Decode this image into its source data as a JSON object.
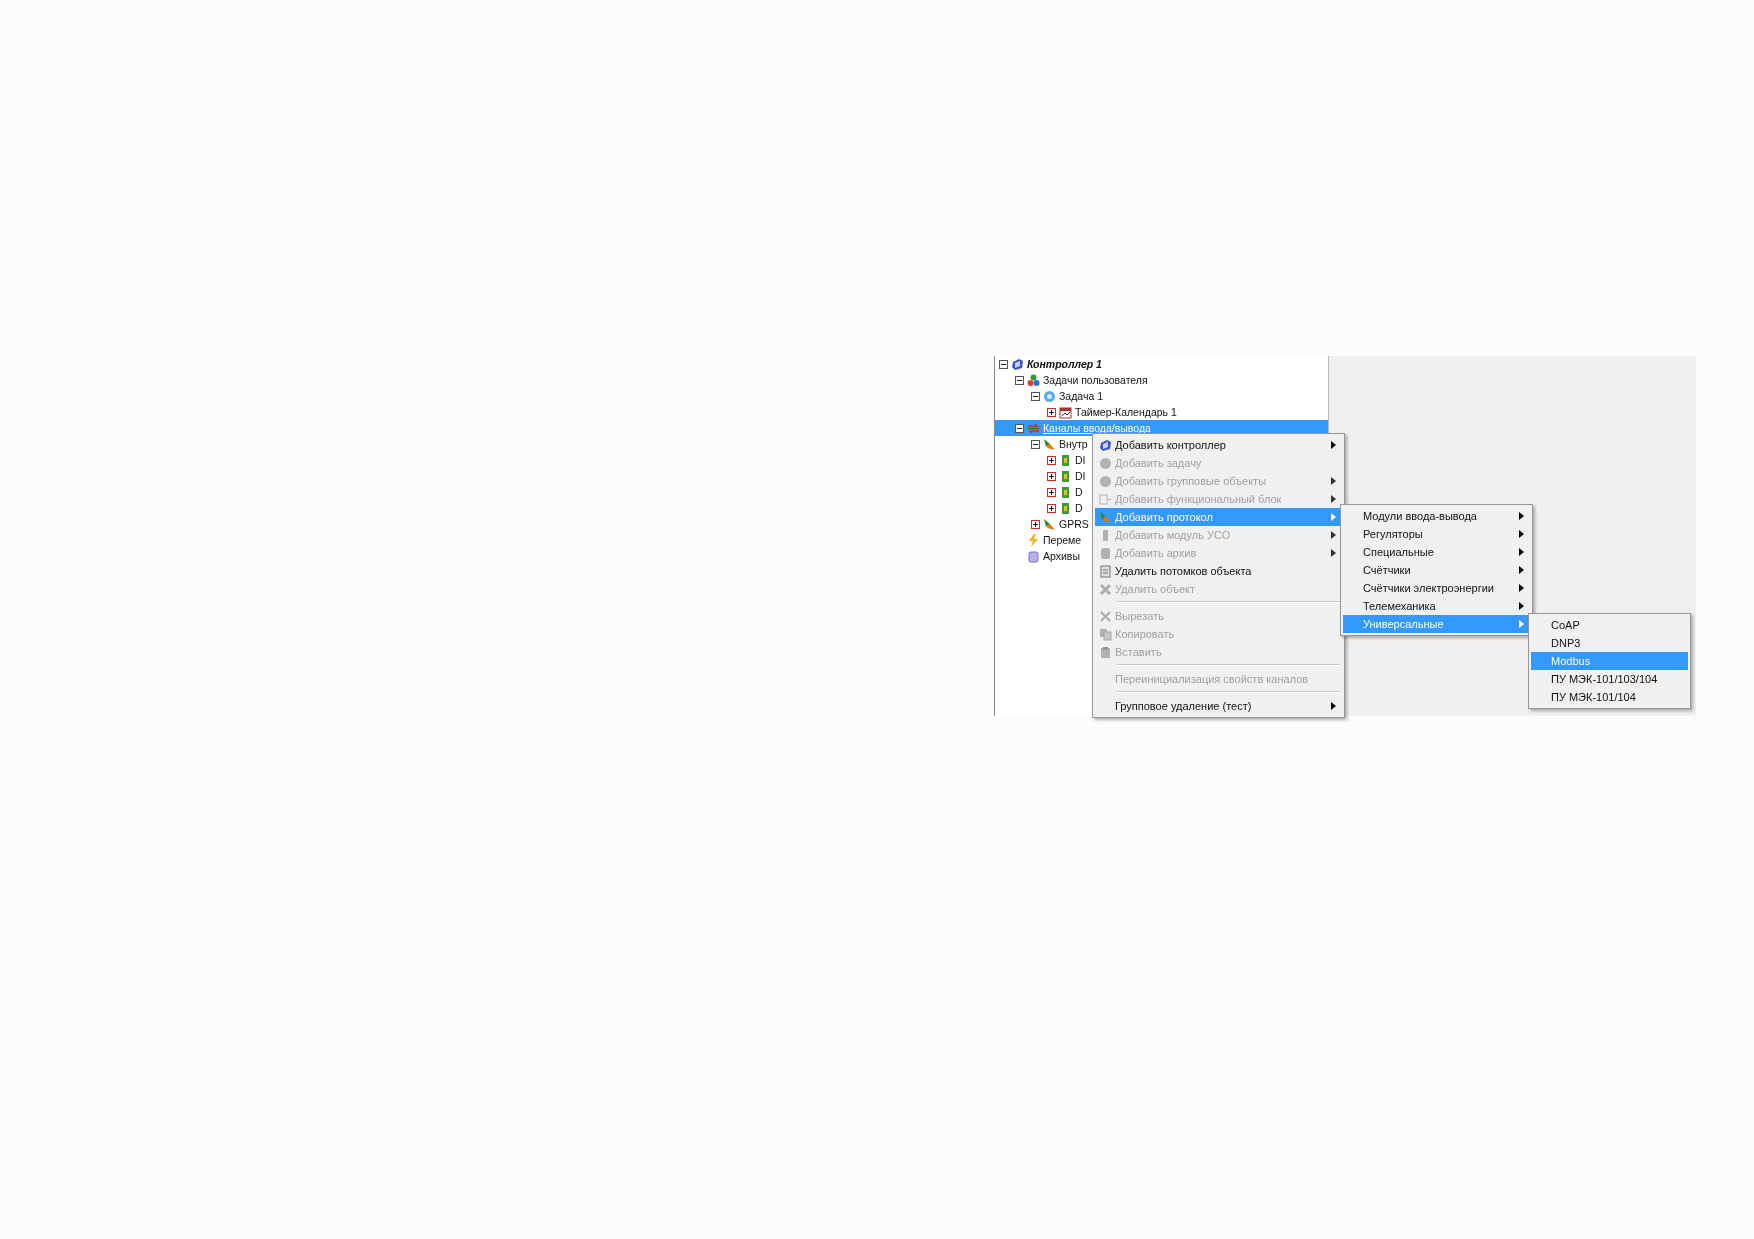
{
  "tree": [
    {
      "label": "Контроллер 1",
      "expanded": true,
      "selected": false,
      "children": [
        {
          "label": "Задачи пользователя",
          "expanded": true,
          "selected": false,
          "children": [
            {
              "label": "Задача 1",
              "expanded": true,
              "selected": false,
              "children": [
                {
                  "label": "Таймер-Календарь 1",
                  "expanded": false,
                  "selected": false
                }
              ]
            }
          ]
        },
        {
          "label": "Каналы ввода/вывода",
          "expanded": true,
          "selected": true,
          "children": [
            {
              "label": "Внутр",
              "expanded": true,
              "selected": false,
              "children": [
                {
                  "label": "DI",
                  "expanded": false,
                  "selected": false
                },
                {
                  "label": "DI",
                  "expanded": false,
                  "selected": false
                },
                {
                  "label": "D",
                  "expanded": false,
                  "selected": false
                },
                {
                  "label": "D",
                  "expanded": false,
                  "selected": false
                }
              ]
            },
            {
              "label": "GPRS",
              "expanded": false,
              "selected": false
            }
          ]
        },
        {
          "label": "Переме",
          "selected": false
        },
        {
          "label": "Архивы",
          "selected": false
        }
      ]
    }
  ],
  "context_menu": {
    "items": [
      {
        "kind": "item",
        "label": "Добавить контроллер",
        "disabled": false,
        "selected": false,
        "has_submenu": true
      },
      {
        "kind": "item",
        "label": "Добавить задачу",
        "disabled": true,
        "selected": false,
        "has_submenu": false
      },
      {
        "kind": "item",
        "label": "Добавить групповые объекты",
        "disabled": true,
        "selected": false,
        "has_submenu": true
      },
      {
        "kind": "item",
        "label": "Добавить функциональный блок",
        "disabled": true,
        "selected": false,
        "has_submenu": true
      },
      {
        "kind": "item",
        "label": "Добавить протокол",
        "disabled": false,
        "selected": true,
        "has_submenu": true
      },
      {
        "kind": "item",
        "label": "Добавить модуль УСО",
        "disabled": true,
        "selected": false,
        "has_submenu": true
      },
      {
        "kind": "item",
        "label": "Добавить архив",
        "disabled": true,
        "selected": false,
        "has_submenu": true
      },
      {
        "kind": "item",
        "label": "Удалить потомков объекта",
        "disabled": false,
        "selected": false,
        "has_submenu": false
      },
      {
        "kind": "item",
        "label": "Удалить объект",
        "disabled": true,
        "selected": false,
        "has_submenu": false
      },
      {
        "kind": "separator"
      },
      {
        "kind": "item",
        "label": "Вырезать",
        "disabled": true,
        "selected": false,
        "has_submenu": false
      },
      {
        "kind": "item",
        "label": "Копировать",
        "disabled": true,
        "selected": false,
        "has_submenu": false
      },
      {
        "kind": "item",
        "label": "Вставить",
        "disabled": true,
        "selected": false,
        "has_submenu": false
      },
      {
        "kind": "separator"
      },
      {
        "kind": "item",
        "label": "Переинициализация свойств каналов",
        "disabled": true,
        "selected": false,
        "has_submenu": false
      },
      {
        "kind": "separator"
      },
      {
        "kind": "item",
        "label": "Групповое удаление (тест)",
        "disabled": false,
        "selected": false,
        "has_submenu": true
      }
    ]
  },
  "protocol_submenu": {
    "items": [
      {
        "kind": "item",
        "label": "Модули ввода-вывода",
        "disabled": false,
        "selected": false,
        "has_submenu": true
      },
      {
        "kind": "item",
        "label": "Регуляторы",
        "disabled": false,
        "selected": false,
        "has_submenu": true
      },
      {
        "kind": "item",
        "label": "Специальные",
        "disabled": false,
        "selected": false,
        "has_submenu": true
      },
      {
        "kind": "item",
        "label": "Счётчики",
        "disabled": false,
        "selected": false,
        "has_submenu": true
      },
      {
        "kind": "item",
        "label": "Счётчики электроэнергии",
        "disabled": false,
        "selected": false,
        "has_submenu": true
      },
      {
        "kind": "item",
        "label": "Телемеханика",
        "disabled": false,
        "selected": false,
        "has_submenu": true
      },
      {
        "kind": "item",
        "label": "Универсальные",
        "disabled": false,
        "selected": true,
        "has_submenu": true
      }
    ]
  },
  "universal_submenu": {
    "items": [
      {
        "kind": "item",
        "label": "CoAP",
        "disabled": false,
        "selected": false,
        "has_submenu": false
      },
      {
        "kind": "item",
        "label": "DNP3",
        "disabled": false,
        "selected": false,
        "has_submenu": false
      },
      {
        "kind": "item",
        "label": "Modbus",
        "disabled": false,
        "selected": true,
        "has_submenu": false
      },
      {
        "kind": "item",
        "label": "ПУ МЭК-101/103/104",
        "disabled": false,
        "selected": false,
        "has_submenu": false
      },
      {
        "kind": "item",
        "label": "ПУ МЭК-101/104",
        "disabled": false,
        "selected": false,
        "has_submenu": false
      }
    ]
  }
}
